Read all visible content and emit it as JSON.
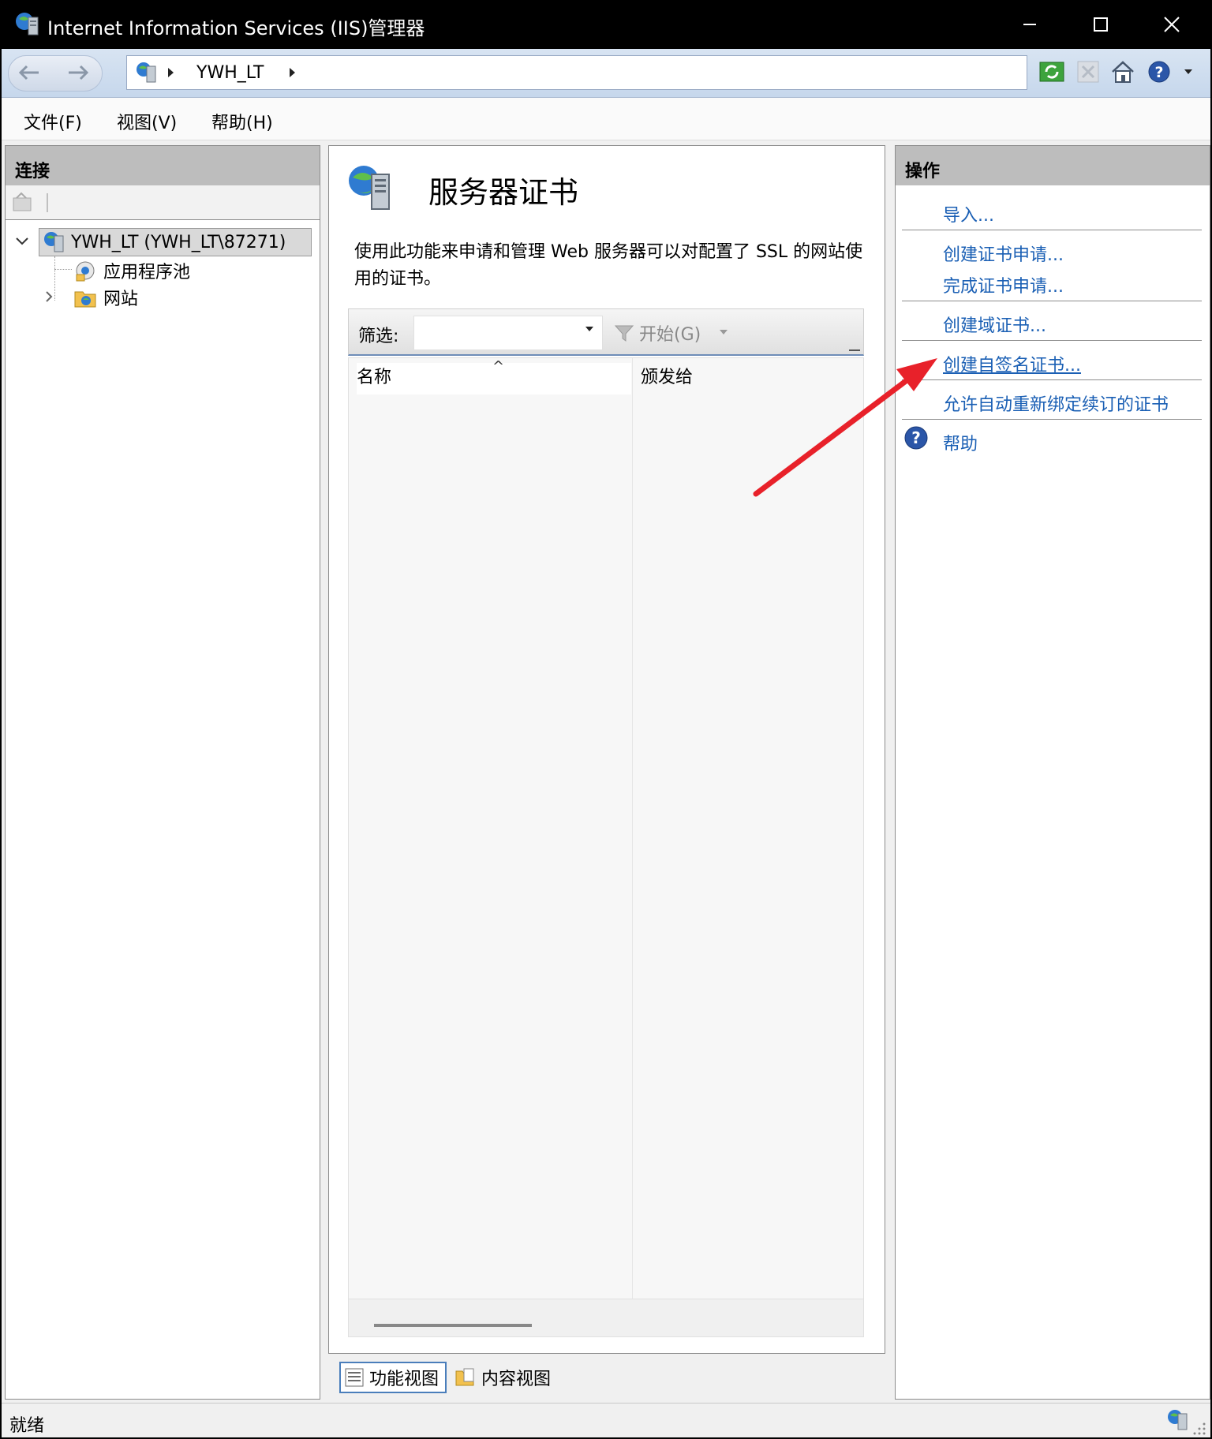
{
  "window": {
    "title": "Internet Information Services (IIS)管理器"
  },
  "address": {
    "crumbs": [
      "YWH_LT"
    ]
  },
  "menu": {
    "items": [
      "文件(F)",
      "视图(V)",
      "帮助(H)"
    ]
  },
  "connections": {
    "header": "连接",
    "tree": {
      "server": "YWH_LT (YWH_LT\\87271)",
      "children": [
        "应用程序池",
        "网站"
      ]
    }
  },
  "center": {
    "title": "服务器证书",
    "description": "使用此功能来申请和管理 Web 服务器可以对配置了 SSL 的网站使用的证书。",
    "filter": {
      "label": "筛选:",
      "value": "",
      "go_label": "开始(G)"
    },
    "columns": [
      "名称",
      "颁发给"
    ],
    "tabs": [
      "功能视图",
      "内容视图"
    ]
  },
  "actions": {
    "header": "操作",
    "items": [
      "导入...",
      "创建证书申请...",
      "完成证书申请...",
      "创建域证书...",
      "创建自签名证书...",
      "允许自动重新绑定续订的证书",
      "帮助"
    ]
  },
  "status": {
    "text": "就绪"
  },
  "colors": {
    "link": "#1a5fb4",
    "annotation_arrow": "#e8212a",
    "pane_header": "#bdbdbd"
  }
}
